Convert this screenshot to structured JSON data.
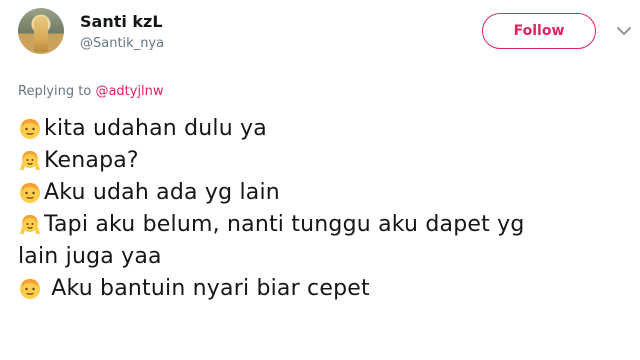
{
  "author": {
    "display_name": "Santi kzL",
    "handle": "@Santik_nya"
  },
  "actions": {
    "follow_label": "Follow"
  },
  "reply": {
    "prefix": "Replying to ",
    "mention": "@adtyjlnw"
  },
  "tweet": {
    "lines": [
      {
        "emoji": "boy-face",
        "text": "kita udahan dulu ya"
      },
      {
        "emoji": "girl-hands-up",
        "text": "Kenapa?"
      },
      {
        "emoji": "boy-face",
        "text": "Aku udah ada yg lain"
      },
      {
        "emoji": "girl-hands-up",
        "text": "Tapi aku belum, nanti tunggu aku dapet yg"
      },
      {
        "emoji": "",
        "text": "lain juga yaa"
      },
      {
        "emoji": "boy-face",
        "text": " Aku bantuin nyari biar cepet"
      }
    ]
  },
  "colors": {
    "accent": "#e0245e",
    "secondary_text": "#657786",
    "primary_text": "#14171a"
  }
}
